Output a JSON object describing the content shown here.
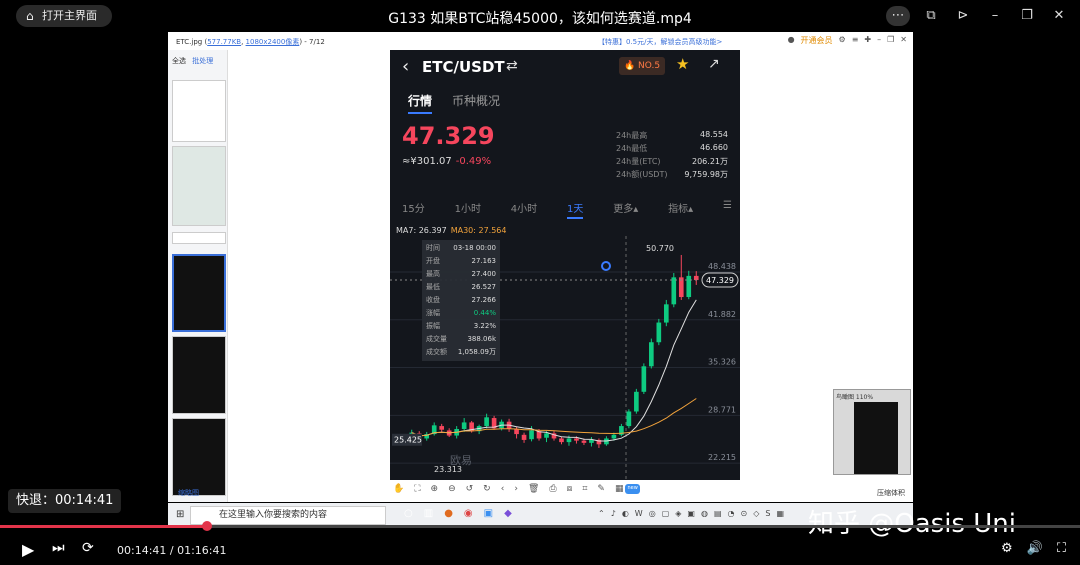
{
  "header": {
    "home_label": "打开主界面",
    "title": "G133  如果BTC站稳45000，该如何选赛道.mp4"
  },
  "viewer": {
    "filename": "ETC.jpg",
    "filesize": "577.77KB",
    "dimensions": "1080x2400像素",
    "page": "- 7/12",
    "ad_text": "【特惠】0.5元/天，解锁会员高级功能>",
    "upgrade": "开通会员",
    "select_all": "全选",
    "batch": "批处理",
    "thumbs_label": "缩略图",
    "fit_label": "压缩体积",
    "new_badge": "new",
    "minimap_title": "鸟瞰图 110%"
  },
  "trading": {
    "pair": "ETC/USDT",
    "rank": "NO.5",
    "tab_market": "行情",
    "tab_overview": "币种概况",
    "price": "47.329",
    "cny_price": "≈¥301.07",
    "change_pct": "-0.49%",
    "stats": [
      {
        "k": "24h最高",
        "v": "48.554"
      },
      {
        "k": "24h最低",
        "v": "46.660"
      },
      {
        "k": "24h量(ETC)",
        "v": "206.21万"
      },
      {
        "k": "24h额(USDT)",
        "v": "9,759.98万"
      }
    ],
    "intervals": [
      "15分",
      "1小时",
      "4小时",
      "1天",
      "更多▴",
      "指标▴"
    ],
    "active_interval": "1天",
    "ma7": "MA7: 26.397",
    "ma30": "MA30: 27.564",
    "tooltip": [
      {
        "k": "时间",
        "v": "03-18 00:00"
      },
      {
        "k": "开盘",
        "v": "27.163"
      },
      {
        "k": "最高",
        "v": "27.400"
      },
      {
        "k": "最低",
        "v": "26.527"
      },
      {
        "k": "收盘",
        "v": "27.266"
      },
      {
        "k": "涨幅",
        "v": "0.44%"
      },
      {
        "k": "振幅",
        "v": "3.22%"
      },
      {
        "k": "成交量",
        "v": "388.06k"
      },
      {
        "k": "成交额",
        "v": "1,058.09万"
      }
    ],
    "peak_label": "50.770",
    "low_label": "23.313",
    "left_label": "25.425",
    "cur_label": "47.329",
    "brand": "欧易"
  },
  "chart_data": {
    "type": "candlestick",
    "y_ticks": [
      "48.438",
      "41.882",
      "35.326",
      "28.771",
      "22.215"
    ],
    "ylim": [
      21.0,
      52.0
    ],
    "candles": [
      [
        25.6,
        26.4,
        25.0,
        26.8
      ],
      [
        26.3,
        25.5,
        25.2,
        26.6
      ],
      [
        25.6,
        26.2,
        25.3,
        26.5
      ],
      [
        26.2,
        27.4,
        26.0,
        27.8
      ],
      [
        27.3,
        26.8,
        26.5,
        27.6
      ],
      [
        26.7,
        26.0,
        25.8,
        27.0
      ],
      [
        26.0,
        26.9,
        25.6,
        27.3
      ],
      [
        26.9,
        27.8,
        26.5,
        28.4
      ],
      [
        27.8,
        26.6,
        26.4,
        28.0
      ],
      [
        26.6,
        27.3,
        26.2,
        27.5
      ],
      [
        27.3,
        28.5,
        27.0,
        29.0
      ],
      [
        28.4,
        27.0,
        26.8,
        28.7
      ],
      [
        27.0,
        27.9,
        26.7,
        28.2
      ],
      [
        27.9,
        26.9,
        26.5,
        28.3
      ],
      [
        26.9,
        26.2,
        25.6,
        27.2
      ],
      [
        26.1,
        25.4,
        25.0,
        26.4
      ],
      [
        25.5,
        26.7,
        25.2,
        27.3
      ],
      [
        26.6,
        25.6,
        25.3,
        26.9
      ],
      [
        25.7,
        26.3,
        25.1,
        26.6
      ],
      [
        26.3,
        25.6,
        25.3,
        26.6
      ],
      [
        25.6,
        25.1,
        24.8,
        25.8
      ],
      [
        25.1,
        25.6,
        24.6,
        26.0
      ],
      [
        25.6,
        25.3,
        24.9,
        25.9
      ],
      [
        25.3,
        25.0,
        24.7,
        25.6
      ],
      [
        25.0,
        25.4,
        24.5,
        25.8
      ],
      [
        25.4,
        24.8,
        24.3,
        25.6
      ],
      [
        24.8,
        25.6,
        24.6,
        25.9
      ],
      [
        25.6,
        26.1,
        25.3,
        26.4
      ],
      [
        26.1,
        27.3,
        25.9,
        27.6
      ],
      [
        27.3,
        29.3,
        27.0,
        29.6
      ],
      [
        29.3,
        32.0,
        29.0,
        32.4
      ],
      [
        32.0,
        35.5,
        31.7,
        35.9
      ],
      [
        35.5,
        38.8,
        35.2,
        39.3
      ],
      [
        38.8,
        41.5,
        38.4,
        42.0
      ],
      [
        41.5,
        44.0,
        41.0,
        44.6
      ],
      [
        44.0,
        47.7,
        43.6,
        48.3
      ],
      [
        47.7,
        45.0,
        44.6,
        50.77
      ],
      [
        45.0,
        47.9,
        44.7,
        48.6
      ],
      [
        47.9,
        47.329,
        46.66,
        48.554
      ]
    ]
  },
  "taskbar": {
    "search_placeholder": "在这里输入你要搜索的内容"
  },
  "player": {
    "seek_label": "快退：00:14:41",
    "watermark": "知乎 @Oasis Uni",
    "time": "00:14:41 / 01:16:41",
    "progress": 0.1915
  }
}
